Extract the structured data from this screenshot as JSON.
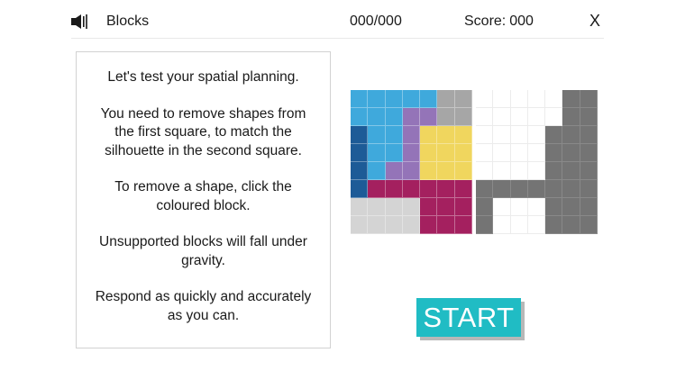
{
  "header": {
    "title": "Blocks",
    "progress": "000/000",
    "score_label": "Score:",
    "score_value": "000",
    "close_label": "X",
    "icons": {
      "sound": "speaker-icon"
    }
  },
  "instructions": {
    "paragraphs": [
      "Let's test your spatial planning.",
      "You need to remove shapes from the first square, to match the silhouette in the second square.",
      "To remove a shape, click the coloured block.",
      "Unsupported blocks will fall under gravity.",
      "Respond as quickly and accurately as you can."
    ]
  },
  "puzzle": {
    "colors": {
      "sky": "#3fa9dc",
      "navy": "#1d5b97",
      "purple": "#9474b8",
      "yellow": "#f0d65e",
      "magenta": "#a4205f",
      "grey": "#a6a6a6",
      "light": "#d4d4d4",
      "silhouette": "#747474",
      "empty": "#ffffff"
    },
    "source_grid": [
      [
        "sky",
        "sky",
        "sky",
        "sky",
        "sky",
        "grey",
        "grey"
      ],
      [
        "sky",
        "sky",
        "sky",
        "purple",
        "purple",
        "grey",
        "grey"
      ],
      [
        "navy",
        "sky",
        "sky",
        "purple",
        "yellow",
        "yellow",
        "yellow"
      ],
      [
        "navy",
        "sky",
        "sky",
        "purple",
        "yellow",
        "yellow",
        "yellow"
      ],
      [
        "navy",
        "sky",
        "purple",
        "purple",
        "yellow",
        "yellow",
        "yellow"
      ],
      [
        "navy",
        "magenta",
        "magenta",
        "magenta",
        "magenta",
        "magenta",
        "magenta"
      ],
      [
        "light",
        "light",
        "light",
        "light",
        "magenta",
        "magenta",
        "magenta"
      ],
      [
        "light",
        "light",
        "light",
        "light",
        "magenta",
        "magenta",
        "magenta"
      ]
    ],
    "target_grid": [
      [
        0,
        0,
        0,
        0,
        0,
        1,
        1
      ],
      [
        0,
        0,
        0,
        0,
        0,
        1,
        1
      ],
      [
        0,
        0,
        0,
        0,
        1,
        1,
        1
      ],
      [
        0,
        0,
        0,
        0,
        1,
        1,
        1
      ],
      [
        0,
        0,
        0,
        0,
        1,
        1,
        1
      ],
      [
        1,
        1,
        1,
        1,
        1,
        1,
        1
      ],
      [
        1,
        0,
        0,
        0,
        1,
        1,
        1
      ],
      [
        1,
        0,
        0,
        0,
        1,
        1,
        1
      ]
    ]
  },
  "actions": {
    "start_label": "START"
  }
}
